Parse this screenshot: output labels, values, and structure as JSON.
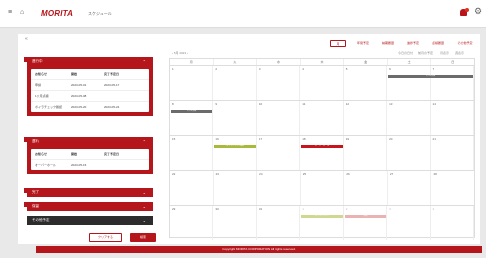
{
  "topbar": {
    "menu_icon": "hamburger-icon",
    "home_icon": "home-icon",
    "logo": "MORITA",
    "app_title": "スケジュール",
    "notification_icon": "bell-icon",
    "settings_icon": "gear-icon"
  },
  "back_label": "«",
  "panels": [
    {
      "title": "進行中",
      "expanded": true,
      "headers": [
        "お知らせ",
        "開始",
        "完了予定日"
      ],
      "rows": [
        [
          "申請",
          "2023-05-01",
          "2023-05-17"
        ],
        [
          "1ヶ月点検",
          "2023-05-08",
          ""
        ],
        [
          "ボイラチェック確認",
          "2023-05-20",
          "2023-05-24"
        ]
      ]
    },
    {
      "title": "遅れ",
      "expanded": true,
      "headers": [
        "お知らせ",
        "開始",
        "完了予定日"
      ],
      "rows": [
        [
          "オーバーホール",
          "2023-05-15",
          ""
        ]
      ]
    },
    {
      "title": "完了",
      "expanded": false
    },
    {
      "title": "保留",
      "expanded": false
    },
    {
      "title": "その他予定",
      "expanded": false
    }
  ],
  "buttons": {
    "clear": "クリアする",
    "search": "検索"
  },
  "calendar": {
    "views": [
      "月",
      "年間予定",
      "納期履歴",
      "進捗予定",
      "点検履歴",
      "その他予定"
    ],
    "month_label": "‹ 5月 2023 ›",
    "sub_nav": [
      "今日の日付",
      "前月の予定",
      "月表示",
      "週表示"
    ],
    "weekdays": [
      "月",
      "火",
      "水",
      "木",
      "金",
      "土",
      "日"
    ],
    "weeks": [
      [
        "1",
        "2",
        "3",
        "4",
        "5",
        "6",
        "7"
      ],
      [
        "8",
        "9",
        "10",
        "11",
        "12",
        "13",
        "14"
      ],
      [
        "15",
        "16",
        "17",
        "18",
        "19",
        "20",
        "21"
      ],
      [
        "22",
        "23",
        "24",
        "25",
        "26",
        "27",
        "28"
      ],
      [
        "29",
        "30",
        "31",
        "1",
        "2",
        "3",
        "4"
      ]
    ],
    "events": [
      {
        "label": "1ヶ月点検",
        "week": 0,
        "start": 5,
        "span": 2,
        "color": "#6b6b6b"
      },
      {
        "label": "1ヶ月点検",
        "week": 1,
        "start": 0,
        "span": 1,
        "color": "#6b6b6b"
      },
      {
        "label": "ボイラチェック確認",
        "week": 2,
        "start": 1,
        "span": 1,
        "color": "#a9b93a"
      },
      {
        "label": "オーバーホール",
        "week": 2,
        "start": 3,
        "span": 1,
        "color": "#c8141b"
      },
      {
        "label": "ボイラチェック",
        "week": 4,
        "start": 3,
        "span": 1,
        "color": "#cfd88e"
      },
      {
        "label": "点検",
        "week": 4,
        "start": 4,
        "span": 1,
        "color": "#eab3b3"
      }
    ]
  },
  "footer": "Copyright MORITA CORPORATION All rights reserved."
}
